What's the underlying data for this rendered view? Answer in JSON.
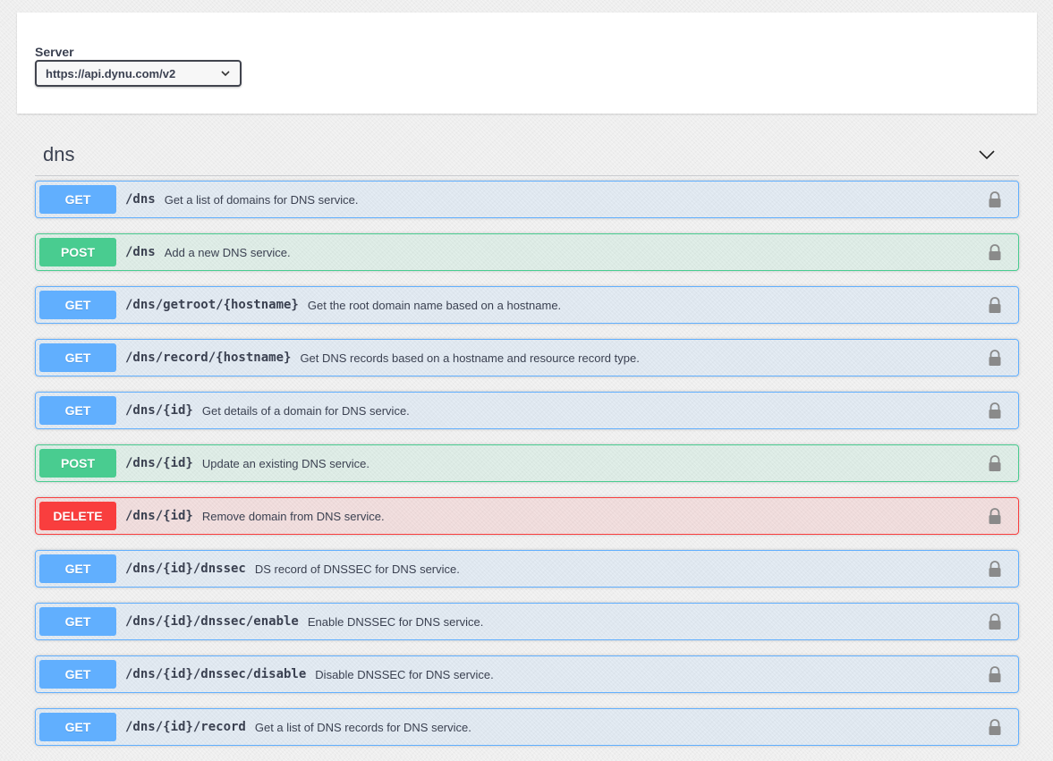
{
  "server": {
    "label": "Server",
    "selected": "https://api.dynu.com/v2"
  },
  "tag": {
    "name": "dns"
  },
  "operations": [
    {
      "method": "GET",
      "path": "/dns",
      "summary": "Get a list of domains for DNS service."
    },
    {
      "method": "POST",
      "path": "/dns",
      "summary": "Add a new DNS service."
    },
    {
      "method": "GET",
      "path": "/dns/getroot/{hostname}",
      "summary": "Get the root domain name based on a hostname."
    },
    {
      "method": "GET",
      "path": "/dns/record/{hostname}",
      "summary": "Get DNS records based on a hostname and resource record type."
    },
    {
      "method": "GET",
      "path": "/dns/{id}",
      "summary": "Get details of a domain for DNS service."
    },
    {
      "method": "POST",
      "path": "/dns/{id}",
      "summary": "Update an existing DNS service."
    },
    {
      "method": "DELETE",
      "path": "/dns/{id}",
      "summary": "Remove domain from DNS service."
    },
    {
      "method": "GET",
      "path": "/dns/{id}/dnssec",
      "summary": "DS record of DNSSEC for DNS service."
    },
    {
      "method": "GET",
      "path": "/dns/{id}/dnssec/enable",
      "summary": "Enable DNSSEC for DNS service."
    },
    {
      "method": "GET",
      "path": "/dns/{id}/dnssec/disable",
      "summary": "Disable DNSSEC for DNS service."
    },
    {
      "method": "GET",
      "path": "/dns/{id}/record",
      "summary": "Get a list of DNS records for DNS service."
    }
  ],
  "colors": {
    "get": "#61affe",
    "post": "#49cc90",
    "delete": "#f93e3e",
    "text": "#3b4151"
  },
  "icons": {
    "select_arrow": "chevron-down-icon",
    "tag_toggle": "chevron-down-icon",
    "authorization": "lock-icon"
  }
}
